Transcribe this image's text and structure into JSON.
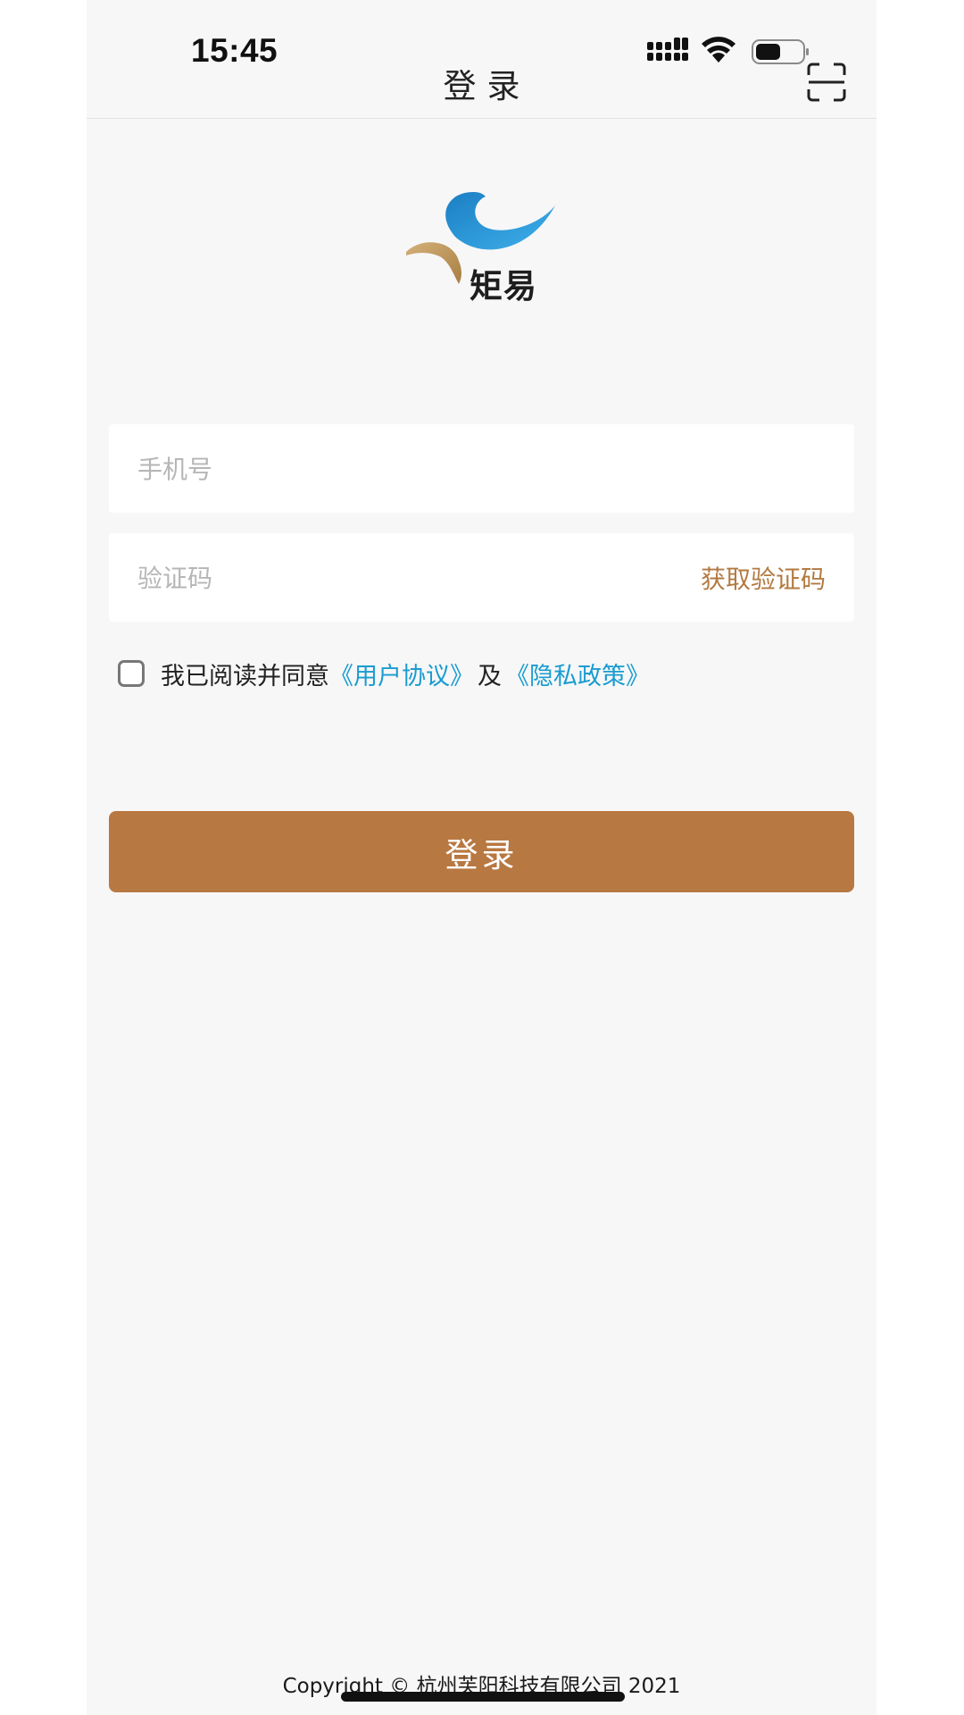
{
  "status_bar": {
    "time": "15:45",
    "icons": [
      "signal-icon",
      "wifi-icon",
      "battery-icon"
    ]
  },
  "nav": {
    "title": "登录",
    "right_icon": "scan-icon"
  },
  "brand": {
    "name": "矩易",
    "logo_colors": {
      "blue": "#1b8fd4",
      "gold": "#c49a5a"
    }
  },
  "form": {
    "phone_placeholder": "手机号",
    "phone_value": "",
    "code_placeholder": "验证码",
    "code_value": "",
    "get_code_label": "获取验证码"
  },
  "agreement": {
    "checked": false,
    "prefix": "我已阅读并同意",
    "user_agreement": "《用户协议》",
    "and": "及",
    "privacy_policy": "《隐私政策》"
  },
  "login_button": {
    "label": "登录"
  },
  "footer": {
    "copyright": "Copyright © 杭州芙阳科技有限公司 2021"
  },
  "colors": {
    "accent": "#b87842",
    "link": "#1a9cd0",
    "background": "#f7f7f8"
  }
}
